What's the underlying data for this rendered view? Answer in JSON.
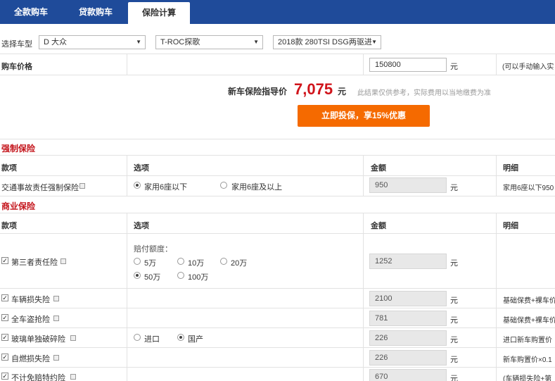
{
  "tabs": [
    "全款购车",
    "贷款购车",
    "保险计算"
  ],
  "car_select": {
    "label": "选择车型",
    "brand": "D 大众",
    "series": "T-ROC探歌",
    "model": "2018款 280TSI DSG两驱进"
  },
  "price": {
    "label": "购车价格",
    "value": "150800",
    "unit": "元",
    "hint": "(可以手动输入实"
  },
  "guide": {
    "label": "新车保险指导价",
    "value": "7,075",
    "unit": "元",
    "note": "此结果仅供参考，实际费用以当地缴费为准"
  },
  "cta_label": "立即投保，享15%优惠",
  "compulsory": {
    "title": "强制保险",
    "headers": [
      "款项",
      "选项",
      "金额",
      "明细"
    ],
    "row": {
      "name": "交通事故责任强制保险",
      "option1": "家用6座以下",
      "option2": "家用6座及以上",
      "amount": "950",
      "unit": "元",
      "detail": "家用6座以下950"
    }
  },
  "commercial": {
    "title": "商业保险",
    "headers": [
      "款项",
      "选项",
      "金额",
      "明细"
    ],
    "third_party": {
      "name": "第三者责任险",
      "payout_label": "赔付额度：",
      "options": [
        "5万",
        "10万",
        "20万",
        "50万",
        "100万"
      ],
      "amount": "1252",
      "unit": "元"
    },
    "rows": [
      {
        "name": "车辆损失险",
        "amount": "2100",
        "unit": "元",
        "detail": "基础保费+裸车价"
      },
      {
        "name": "全车盗抢险",
        "amount": "781",
        "unit": "元",
        "detail": "基础保费+裸车价"
      },
      {
        "name": "玻璃单独破碎险",
        "opt1": "进口",
        "opt2": "国产",
        "amount": "226",
        "unit": "元",
        "detail": "进口新车购置价"
      },
      {
        "name": "自燃损失险",
        "amount": "226",
        "unit": "元",
        "detail": "新车购置价×0.1"
      },
      {
        "name": "不计免赔特约险",
        "amount": "670",
        "unit": "元",
        "detail": "(车辆损失险+第"
      }
    ]
  }
}
